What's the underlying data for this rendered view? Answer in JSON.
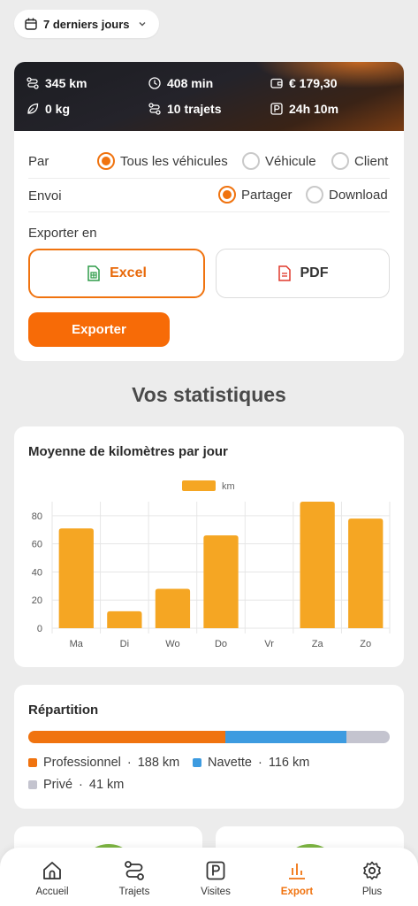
{
  "date_filter": {
    "label": "7 derniers jours"
  },
  "stats": {
    "distance": "345 km",
    "duration": "408 min",
    "cost": "€ 179,30",
    "co2": "0 kg",
    "trips": "10 trajets",
    "parking": "24h 10m"
  },
  "export": {
    "by_label": "Par",
    "by_options": [
      "Tous les véhicules",
      "Véhicule",
      "Client"
    ],
    "by_selected": "Tous les véhicules",
    "send_label": "Envoi",
    "send_options": [
      "Partager",
      "Download"
    ],
    "send_selected": "Partager",
    "format_label": "Exporter en",
    "formats": [
      "Excel",
      "PDF"
    ],
    "format_selected": "Excel",
    "button_label": "Exporter"
  },
  "section_title": "Vos statistiques",
  "chart_data": {
    "type": "bar",
    "title": "Moyenne de kilomètres par jour",
    "categories": [
      "Ma",
      "Di",
      "Wo",
      "Do",
      "Vr",
      "Za",
      "Zo"
    ],
    "series": [
      {
        "name": "km",
        "values": [
          71,
          12,
          28,
          66,
          0,
          90,
          78
        ]
      }
    ],
    "ylim": [
      0,
      90
    ],
    "yticks": [
      0,
      20,
      40,
      60,
      80
    ],
    "grid": true,
    "legend": "top-center",
    "color": "#f5a623"
  },
  "repartition": {
    "title": "Répartition",
    "segments": [
      {
        "label": "Professionnel",
        "value": "188 km",
        "km": 188,
        "color": "#f0730f"
      },
      {
        "label": "Navette",
        "value": "116 km",
        "km": 116,
        "color": "#3d9be0"
      },
      {
        "label": "Privé",
        "value": "41 km",
        "km": 41,
        "color": "#c4c4cf"
      }
    ]
  },
  "tabbar": {
    "items": [
      {
        "label": "Accueil",
        "icon": "home-icon"
      },
      {
        "label": "Trajets",
        "icon": "route-icon"
      },
      {
        "label": "Visites",
        "icon": "parking-icon"
      },
      {
        "label": "Export",
        "icon": "bar-chart-icon"
      },
      {
        "label": "Plus",
        "icon": "gear-icon"
      }
    ],
    "active": "Export"
  },
  "colors": {
    "accent": "#f0730f",
    "background": "#ececec",
    "chart_bar": "#f5a623"
  }
}
